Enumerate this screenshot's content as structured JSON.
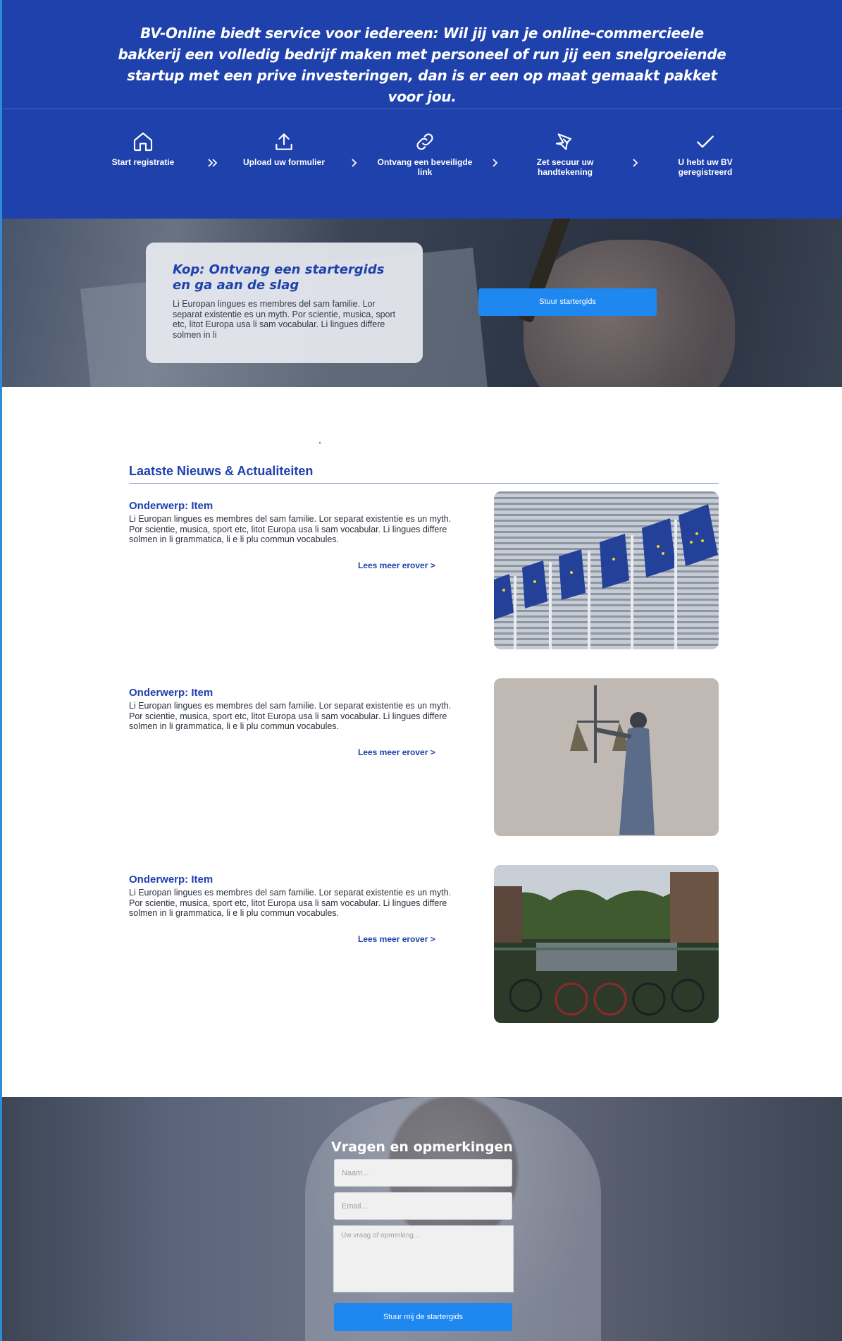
{
  "intro": {
    "text": "BV-Online biedt service voor iedereen: Wil jij van je online-commercieele bakkerij een volledig bedrijf maken met personeel of run jij een snelgroeiende startup met een prive investeringen, dan is er een op maat gemaakt pakket voor jou."
  },
  "steps": [
    {
      "label": "Start registratie",
      "icon": "home-icon"
    },
    {
      "label": "Upload uw formulier",
      "icon": "upload-icon"
    },
    {
      "label": "Ontvang een beveiligde link",
      "icon": "link-icon"
    },
    {
      "label": "Zet secuur uw handtekening",
      "icon": "pen-icon"
    },
    {
      "label": "U hebt uw BV geregistreerd",
      "icon": "check-icon"
    }
  ],
  "hero": {
    "title": "Kop: Ontvang een startergids en ga aan de slag",
    "body": "Li Europan lingues es membres del sam familie. Lor separat existentie es un myth. Por scientie, musica, sport etc, litot Europa usa li sam vocabular. Li lingues differe solmen in li",
    "button": "Stuur startergids"
  },
  "news": {
    "heading": "Laatste Nieuws & Actualiteiten",
    "items": [
      {
        "title": "Onderwerp: Item",
        "body": "Li Europan lingues es membres del sam familie. Lor separat existentie es un myth. Por scientie, musica, sport etc, litot Europa usa li sam vocabular. Li lingues differe solmen in li grammatica, li  e li plu commun vocabules.",
        "link": "Lees meer erover >",
        "image": "eu-flags"
      },
      {
        "title": "Onderwerp: Item",
        "body": "Li Europan lingues es membres del sam familie. Lor separat existentie es un myth. Por scientie, musica, sport etc, litot Europa usa li sam vocabular. Li lingues differe solmen in li grammatica, li  e li plu commun vocabules.",
        "link": "Lees meer erover >",
        "image": "lady-justice"
      },
      {
        "title": "Onderwerp: Item",
        "body": "Li Europan lingues es membres del sam familie. Lor separat existentie es un myth. Por scientie, musica, sport etc, litot Europa usa li sam vocabular. Li lingues differe solmen in li grammatica, li  e li plu commun vocabules.",
        "link": "Lees meer erover >",
        "image": "amsterdam-canal-bikes"
      }
    ]
  },
  "contact": {
    "title": "Vragen en opmerkingen",
    "name_placeholder": "Naam...",
    "email_placeholder": "Email...",
    "question_placeholder": "Uw vraag of opmerking...",
    "button": "Stuur mij de startergids"
  },
  "colors": {
    "brand_blue": "#1f41ac",
    "button_blue": "#1e88f0"
  }
}
